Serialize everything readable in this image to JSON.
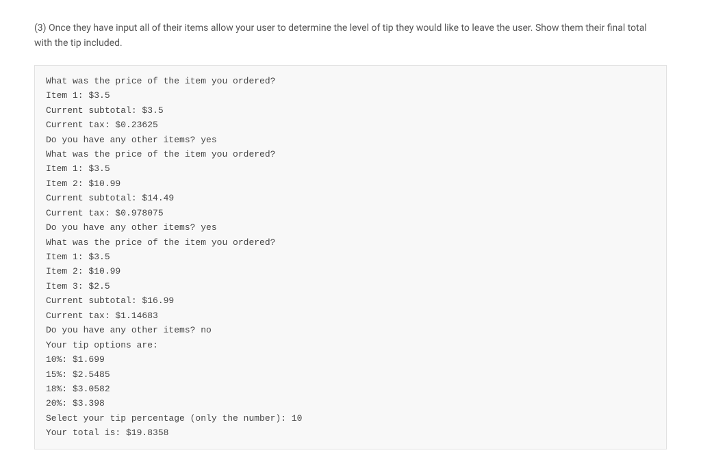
{
  "instruction": "(3) Once they have input all of their items allow your user to determine the level of tip they would like to leave the user. Show them their final total with the tip included.",
  "code_lines": [
    "What was the price of the item you ordered?",
    "Item 1: $3.5",
    "Current subtotal: $3.5",
    "Current tax: $0.23625",
    "Do you have any other items? yes",
    "What was the price of the item you ordered?",
    "Item 1: $3.5",
    "Item 2: $10.99",
    "Current subtotal: $14.49",
    "Current tax: $0.978075",
    "Do you have any other items? yes",
    "What was the price of the item you ordered?",
    "Item 1: $3.5",
    "Item 2: $10.99",
    "Item 3: $2.5",
    "Current subtotal: $16.99",
    "Current tax: $1.14683",
    "Do you have any other items? no",
    "Your tip options are:",
    "10%: $1.699",
    "15%: $2.5485",
    "18%: $3.0582",
    "20%: $3.398",
    "Select your tip percentage (only the number): 10",
    "Your total is: $19.8358"
  ]
}
